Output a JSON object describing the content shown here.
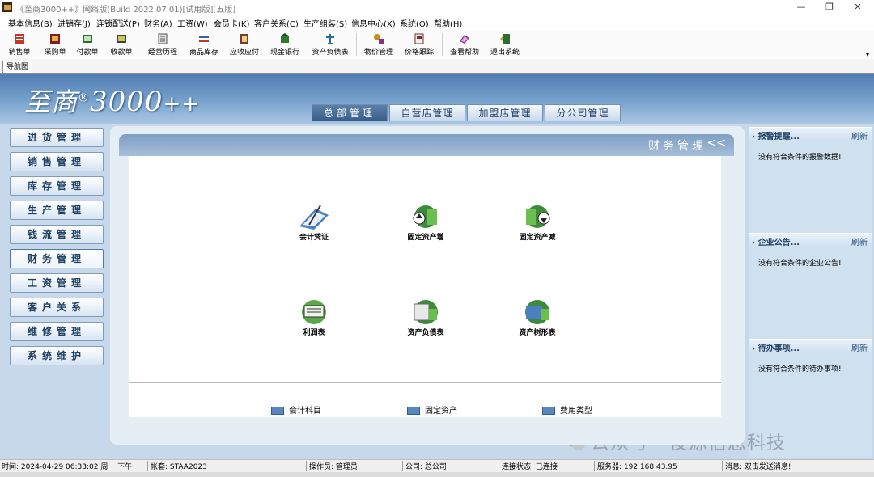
{
  "window": {
    "title": "《至商3000++》网络版(Build 2022.07.01)[试用版][五版]",
    "controls": [
      "—",
      "❐",
      "✕"
    ]
  },
  "menu": [
    "基本信息(B)",
    "进销存(J)",
    "连锁配送(P)",
    "财务(A)",
    "工资(W)",
    "会员卡(K)",
    "客户关系(C)",
    "生产组装(S)",
    "信息中心(X)",
    "系统(O)",
    "帮助(H)"
  ],
  "toolbar": {
    "buttons": [
      "销售单",
      "采购单",
      "付款单",
      "收款单",
      "经营历程",
      "商品库存",
      "应收应付",
      "现金银行",
      "资产负债表",
      "物价管理",
      "价格跟踪",
      "查看帮助",
      "退出系统"
    ],
    "overflow": "▾"
  },
  "tabs": {
    "nav": "导航图"
  },
  "banner": {
    "logo_main": "至商",
    "logo_reg": "®",
    "logo_num": "3000",
    "logo_plus": "++",
    "top_tabs": [
      "总部管理",
      "自营店管理",
      "加盟店管理",
      "分公司管理"
    ]
  },
  "leftnav": [
    "进货管理",
    "销售管理",
    "库存管理",
    "生产管理",
    "钱流管理",
    "财务管理",
    "工资管理",
    "客户关系",
    "维修管理",
    "系统维护"
  ],
  "center": {
    "title": "财务管理",
    "collapse": "<<",
    "items": [
      "会计凭证",
      "固定资产增",
      "固定资产减",
      "利润表",
      "资产负债表",
      "资产树形表"
    ],
    "links": [
      "会计科目",
      "固定资产",
      "费用类型"
    ]
  },
  "right_panels": [
    {
      "title": "报警提醒...",
      "refresh": "刷新",
      "text": "没有符合条件的报警数据!"
    },
    {
      "title": "企业公告...",
      "refresh": "刷新",
      "text": "没有符合条件的企业公告!"
    },
    {
      "title": "待办事项...",
      "refresh": "刷新",
      "text": "没有符合条件的待办事项!"
    }
  ],
  "watermark": "公众号 · 俊源信息科技",
  "status": {
    "time": "时间: 2024-04-29 06:33:02 周一 下午",
    "account": "帐套: STAA2023",
    "operator": "操作员: 管理员",
    "company": "公司: 总公司",
    "connection": "连接状态: 已连接",
    "server": "服务器: 192.168.43.95",
    "message": "消息: 双击发送消息!"
  },
  "colors": {
    "banner": "#4f7cb0",
    "workspace": "#c6d8ea",
    "active_tab": "#385d88",
    "nav_text": "#1f3f63"
  }
}
